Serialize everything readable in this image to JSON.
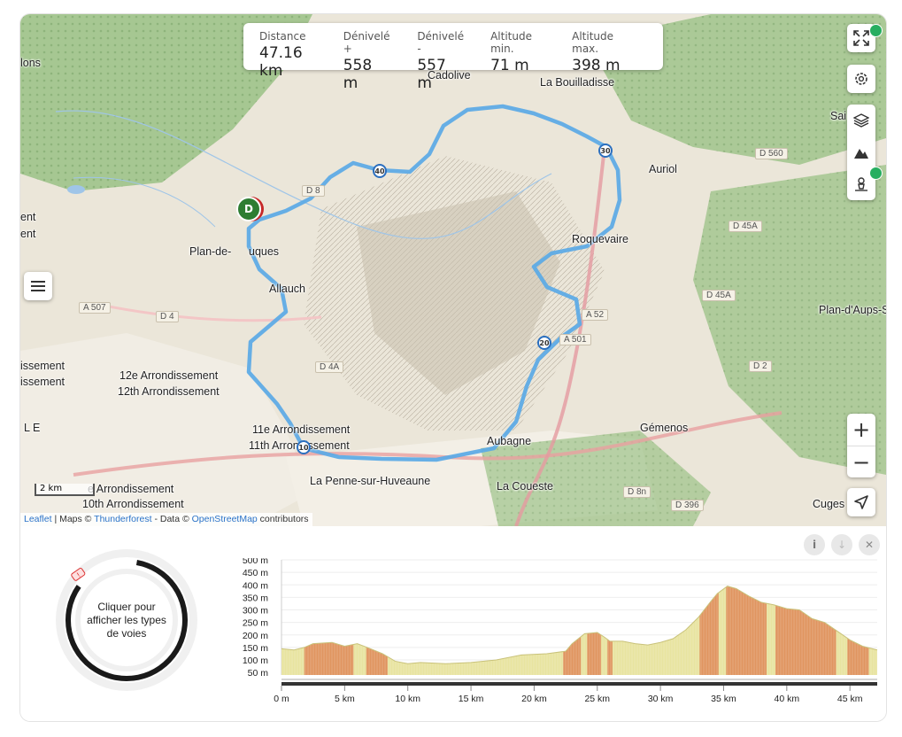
{
  "stats": [
    {
      "label": "Distance",
      "value": "47.16 km"
    },
    {
      "label": "Dénivelé +",
      "value": "558 m"
    },
    {
      "label": "Dénivelé -",
      "value": "557 m"
    },
    {
      "label": "Altitude min.",
      "value": "71 m"
    },
    {
      "label": "Altitude max.",
      "value": "398 m"
    }
  ],
  "places": [
    "lons",
    "ent",
    "ent",
    "Cadolive",
    "La Bouilladisse",
    "Sai",
    "Auriol",
    "Plan-de-",
    "uques",
    "Allauch",
    "Roquevaire",
    "Plan-d'Aups-S",
    "issement",
    "issement",
    "12e Arrondissement",
    "12th Arrondissement",
    "11e Arrondissement",
    "11th Arrondissement",
    "L E",
    "Aubagne",
    "Gémenos",
    "La Penne-sur-Huveaune",
    "La Coueste",
    "e Arrondissement",
    "10th Arrondissement",
    "Cuges"
  ],
  "roads": [
    "D 560",
    "D 45A",
    "D 45A",
    "A 507",
    "D 4",
    "D 4A",
    "A 52",
    "A 501",
    "D 2",
    "D 8n",
    "D 396",
    "D 8"
  ],
  "km_markers": [
    "40",
    "30",
    "20",
    "10"
  ],
  "start_marker": "D",
  "scale_label": "2 km",
  "attribution": {
    "leaflet": "Leaflet",
    "sep1": " | Maps © ",
    "thunderforest": "Thunderforest",
    "sep2": " - Data © ",
    "osm": "OpenStreetMap",
    "tail": " contributors"
  },
  "icons": {
    "fullscreen": "fullscreen-icon",
    "settings": "gear-icon",
    "layers": "layers-icon",
    "terrain": "mountain-icon",
    "poi": "person-pin-icon",
    "menu": "hamburger-icon",
    "locate": "navigation-arrow-icon"
  },
  "zoom": {
    "in": "+",
    "out": "−"
  },
  "surface_prompt": "Cliquer pour afficher les types de voies",
  "surface_badge": "!",
  "profile_buttons": {
    "info": "i",
    "download": "↓",
    "close": "✕"
  },
  "colors": {
    "route": "#5aa9e6",
    "profile_fill": "#e8e4a0",
    "steep": "#d9542b",
    "start_marker": "#2e7d32"
  },
  "chart_data": {
    "type": "area",
    "xlabel": "",
    "ylabel": "",
    "x_ticks": [
      "0 m",
      "5 km",
      "10 km",
      "15 km",
      "20 km",
      "25 km",
      "30 km",
      "35 km",
      "40 km",
      "45 km"
    ],
    "y_ticks": [
      "500 m",
      "450 m",
      "400 m",
      "350 m",
      "300 m",
      "250 m",
      "200 m",
      "150 m",
      "100 m",
      "50 m"
    ],
    "xlim": [
      0,
      47.16
    ],
    "ylim": [
      40,
      500
    ],
    "distance_km": [
      0,
      1,
      1.8,
      2.5,
      4,
      5,
      6,
      6.8,
      8,
      9,
      10,
      11,
      13,
      15,
      17,
      19,
      21,
      22.5,
      23,
      24,
      25,
      25.6,
      26,
      27,
      28,
      29,
      30,
      31,
      32,
      33,
      34,
      34.5,
      35.3,
      36,
      37,
      38,
      39,
      40,
      41,
      42,
      43,
      44,
      45,
      46,
      47.16
    ],
    "elevation_m": [
      145,
      140,
      150,
      165,
      170,
      155,
      165,
      150,
      125,
      95,
      85,
      90,
      85,
      90,
      100,
      120,
      125,
      135,
      165,
      205,
      210,
      190,
      175,
      175,
      165,
      160,
      170,
      185,
      220,
      270,
      335,
      365,
      395,
      385,
      355,
      330,
      320,
      305,
      300,
      265,
      250,
      215,
      180,
      155,
      140
    ],
    "steep_segments_km": [
      1.8,
      5.7,
      6.7,
      8.4,
      22.3,
      23.7,
      24.2,
      25.3,
      25.8,
      26.2,
      33.1,
      34.6,
      35.2,
      38.4,
      39.1,
      43.9,
      44.8,
      46.5
    ]
  }
}
